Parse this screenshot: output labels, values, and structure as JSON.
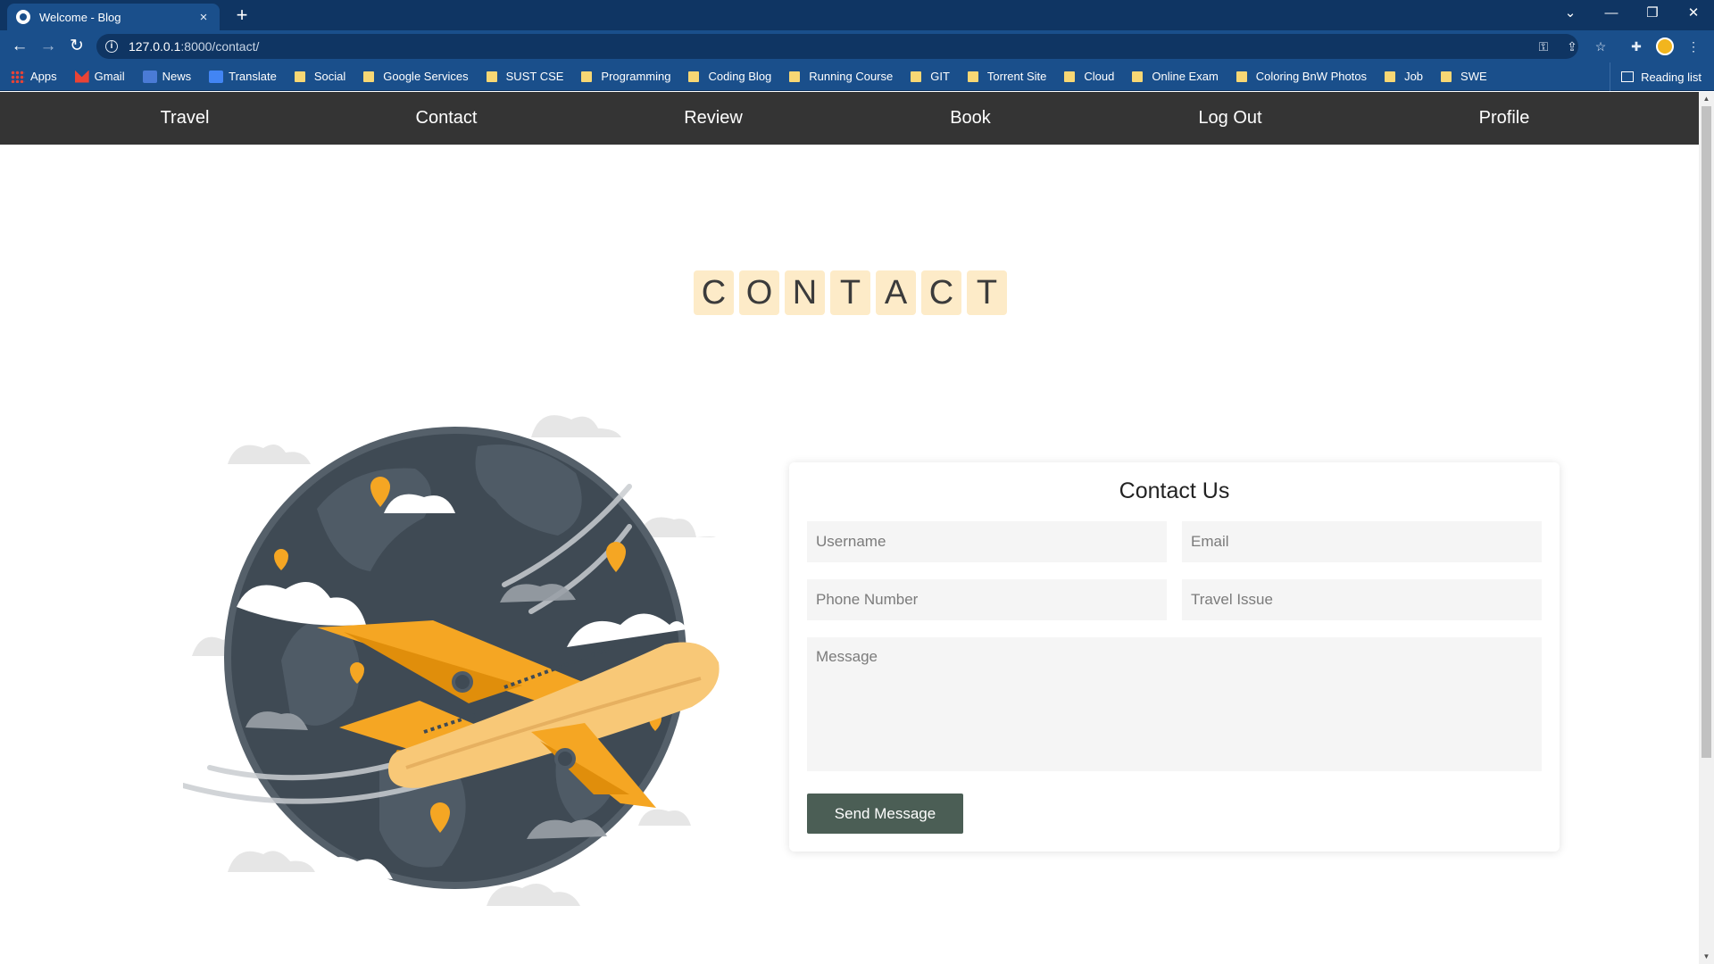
{
  "browser": {
    "tab": {
      "title": "Welcome - Blog",
      "close": "×"
    },
    "new_tab": "+",
    "window_controls": [
      "⌄",
      "—",
      "❐",
      "✕"
    ],
    "nav": {
      "back": "←",
      "forward": "→",
      "reload": "↻"
    },
    "url": {
      "host": "127.0.0.1",
      "path": ":8000/contact/"
    },
    "bookmarks": [
      "Apps",
      "Gmail",
      "News",
      "Translate",
      "Social",
      "Google Services",
      "SUST CSE",
      "Programming",
      "Coding Blog",
      "Running Course",
      "GIT",
      "Torrent Site",
      "Cloud",
      "Online Exam",
      "Coloring BnW Photos",
      "Job",
      "SWE"
    ],
    "reading_list": "Reading list"
  },
  "site_nav": {
    "links": [
      "Travel",
      "Contact",
      "Review",
      "Book",
      "Log Out",
      "Profile"
    ]
  },
  "heading_letters": [
    "C",
    "O",
    "N",
    "T",
    "A",
    "C",
    "T"
  ],
  "form": {
    "title": "Contact Us",
    "username_placeholder": "Username",
    "email_placeholder": "Email",
    "phone_placeholder": "Phone Number",
    "issue_placeholder": "Travel Issue",
    "message_placeholder": "Message",
    "submit_label": "Send Message"
  },
  "colors": {
    "chrome_dark": "#0f3563",
    "chrome": "#1a4f8b",
    "navbar": "#343434",
    "letter_tile": "#fdebc8",
    "button": "#4b5e55",
    "plane": "#f5a623",
    "globe": "#3f4a54"
  }
}
